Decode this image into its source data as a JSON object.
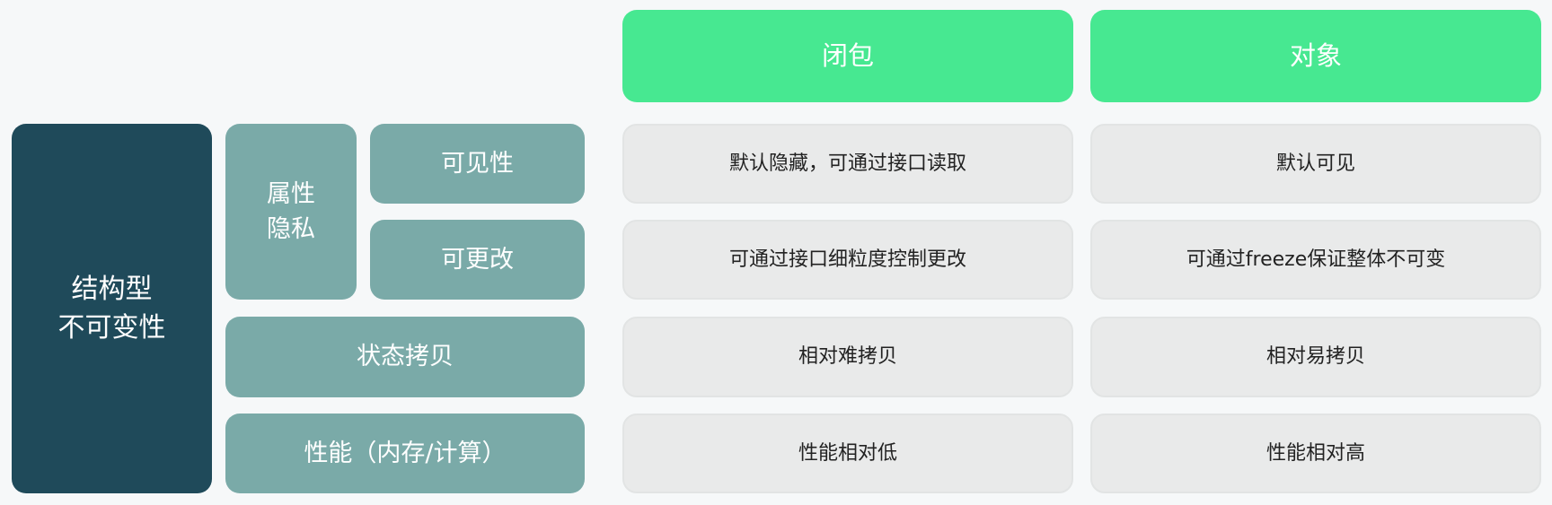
{
  "columns": [
    "闭包",
    "对象"
  ],
  "category": "结构型\n不可变性",
  "subgroup": "属性\n隐私",
  "rows": [
    {
      "label": "可见性",
      "closure": "默认隐藏，可通过接口读取",
      "object": "默认可见"
    },
    {
      "label": "可更改",
      "closure": "可通过接口细粒度控制更改",
      "object": "可通过freeze保证整体不可变"
    },
    {
      "label": "状态拷贝",
      "closure": "相对难拷贝",
      "object": "相对易拷贝"
    },
    {
      "label": "性能（内存/计算）",
      "closure": "性能相对低",
      "object": "性能相对高"
    }
  ],
  "colors": {
    "header": "#47e891",
    "category": "#1f4a5a",
    "label": "#7aaaa8",
    "cell": "#e9eaea"
  }
}
